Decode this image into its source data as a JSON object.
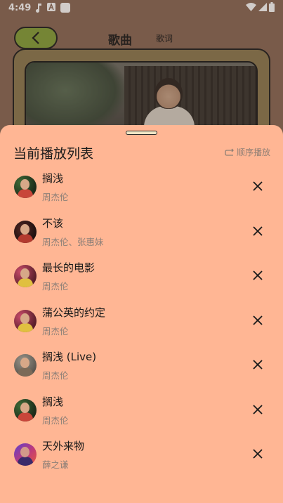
{
  "status_bar": {
    "time": "4:49",
    "icons": [
      "music-note-icon",
      "font-app-icon",
      "blank-app-icon",
      "wifi-icon",
      "signal-icon",
      "battery-icon"
    ]
  },
  "header": {
    "tab_song": "歌曲",
    "tab_lyric": "歌词"
  },
  "playlist": {
    "title": "当前播放列表",
    "play_mode": "顺序播放",
    "items": [
      {
        "title": "搁浅",
        "artist": "周杰伦",
        "avatar": "green-red"
      },
      {
        "title": "不该",
        "artist": "周杰伦、张惠妹",
        "avatar": "dark-red"
      },
      {
        "title": "最长的电影",
        "artist": "周杰伦",
        "avatar": "pink-red"
      },
      {
        "title": "蒲公英的约定",
        "artist": "周杰伦",
        "avatar": "pink-red"
      },
      {
        "title": "搁浅 (Live)",
        "artist": "周杰伦",
        "avatar": "grey-brown"
      },
      {
        "title": "搁浅",
        "artist": "周杰伦",
        "avatar": "green-red"
      },
      {
        "title": "天外来物",
        "artist": "薛之谦",
        "avatar": "purple-red"
      }
    ]
  },
  "colors": {
    "sheet_bg": "#ffb694",
    "background": "#8a6856",
    "back_button": "#84a13a",
    "secondary_text": "#8c7f77"
  }
}
